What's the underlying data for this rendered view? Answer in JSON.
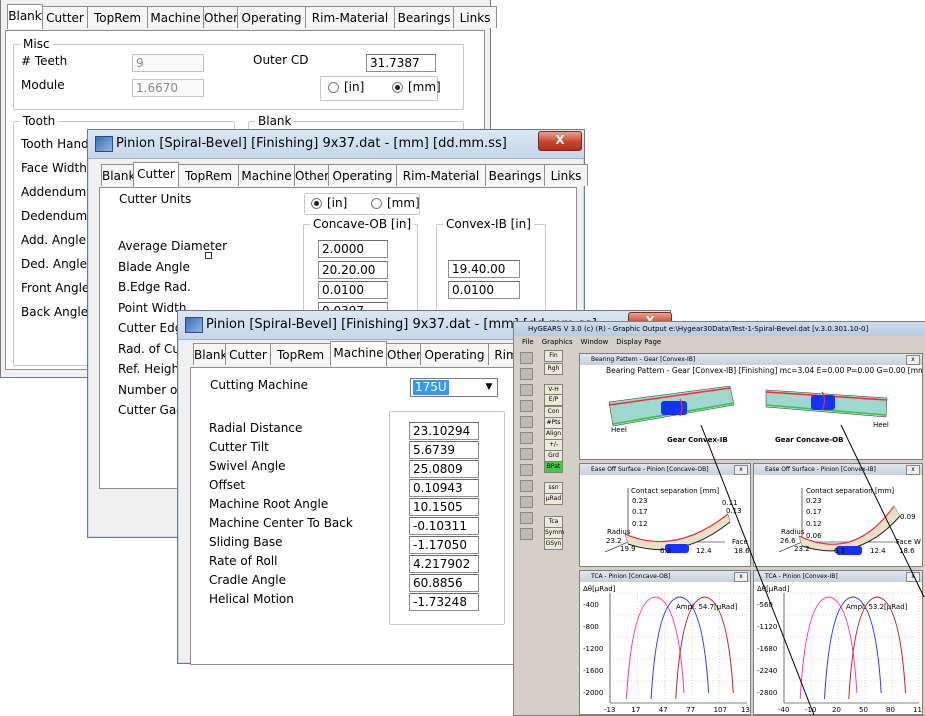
{
  "win1": {
    "tabs": [
      "Blank",
      "Cutter",
      "TopRem",
      "Machine",
      "Other",
      "Operating",
      "Rim-Material",
      "Bearings",
      "Links"
    ],
    "misc_label": "Misc",
    "teeth_label": "# Teeth",
    "teeth_value": "9",
    "module_label": "Module",
    "module_value": "1.6670",
    "outer_cd_label": "Outer CD",
    "outer_cd_value": "31.7387",
    "unit_in": "[in]",
    "unit_mm": "[mm]",
    "tooth_label": "Tooth",
    "blank_label": "Blank",
    "tooth_rows": [
      "Tooth Hand",
      "Face Width",
      "Addendum",
      "Dedendum",
      "Add. Angle",
      "Ded. Angle",
      "Front Angle",
      "Back Angle"
    ]
  },
  "win2": {
    "title": "Pinion [Spiral-Bevel] [Finishing] 9x37.dat - [mm] [dd.mm.ss]",
    "close": "X",
    "tabs": [
      "Blank",
      "Cutter",
      "TopRem",
      "Machine",
      "Other",
      "Operating",
      "Rim-Material",
      "Bearings",
      "Links"
    ],
    "cutter_units_label": "Cutter Units",
    "unit_in": "[in]",
    "unit_mm": "[mm]",
    "concave_label": "Concave-OB [in]",
    "convex_label": "Convex-IB [in]",
    "rows": [
      "Average Diameter",
      "Blade Angle",
      "B.Edge Rad.",
      "Point Width",
      "Cutter Edge",
      "Rad. of Curv",
      "Ref. Height",
      "Number of Bl",
      "Cutter Gaging"
    ],
    "concave_values": [
      "2.0000",
      "20.20.00",
      "0.0100",
      "0.0397"
    ],
    "convex_values": [
      "19.40.00",
      "0.0100"
    ]
  },
  "win3": {
    "title": "Pinion [Spiral-Bevel] [Finishing] 9x37.dat - [mm] [dd.mm.ss]",
    "close": "X",
    "tabs": [
      "Blank",
      "Cutter",
      "TopRem",
      "Machine",
      "Other",
      "Operating",
      "Rim"
    ],
    "cutting_machine_label": "Cutting Machine",
    "cutting_machine_value": "175U",
    "rows": [
      {
        "label": "Radial Distance",
        "value": "23.10294"
      },
      {
        "label": "Cutter Tilt",
        "value": "5.6739"
      },
      {
        "label": "Swivel Angle",
        "value": "25.0809"
      },
      {
        "label": "Offset",
        "value": "0.10943"
      },
      {
        "label": "Machine Root Angle",
        "value": "10.1505"
      },
      {
        "label": "Machine Center To Back",
        "value": "-0.10311"
      },
      {
        "label": "Sliding Base",
        "value": "-1.17050"
      },
      {
        "label": "Rate of Roll",
        "value": "4.217902"
      },
      {
        "label": "Cradle Angle",
        "value": "60.8856"
      },
      {
        "label": "Helical Motion",
        "value": "-1.73248"
      }
    ]
  },
  "hygears": {
    "title": "HyGEARS V 3.0 (c) (R) - Graphic Output e:\\Hygear30Data\\Test-1-Spiral-Bevel.dat [v.3.0.301.10-0]",
    "menu": [
      "File",
      "Graphics",
      "Window",
      "Display Page"
    ],
    "toolbar": [
      "Fin",
      "Rgh",
      "V-H",
      "E/P",
      "Con",
      "#Pts",
      "Align",
      "+/-",
      "Grd",
      "BPat",
      "ssn",
      "μRad",
      "Tca",
      "Symm",
      "GSyn"
    ],
    "bp_window_title": "Bearing Pattern - Gear [Convex-IB]",
    "bp_caption": "Bearing Pattern - Gear [Convex-IB] [Finishing] mc=3.04 E=0.00 P=0.00 G=0.00 [mm] B=0.077[mm]",
    "heel": "Heel",
    "gear_convex": "Gear Convex-IB",
    "gear_concave": "Gear Concave-OB",
    "eo_concave_title": "Ease Off Surface - Pinion [Concave-OB]",
    "eo_convex_title": "Ease Off Surface - Pinion [Convex-IB]",
    "contact_sep": "Contact separation [mm]",
    "eo1_vals": [
      "0.23",
      "0.17",
      "0.12",
      "0.11",
      "0.13"
    ],
    "eo1_axis": [
      "Radius",
      "23.2",
      "19.9",
      "6.2",
      "12.4",
      "18.6",
      "Face W"
    ],
    "eo2_vals": [
      "0.23",
      "0.17",
      "0.12",
      "0.06",
      "0.09"
    ],
    "eo2_axis": [
      "Radius",
      "26.6",
      "23.2",
      "6.2",
      "12.4",
      "18.6",
      "Face W"
    ],
    "tca_concave_title": "TCA - Pinion [Concave-OB]",
    "tca_convex_title": "TCA - Pinion [Convex-IB]",
    "tca_unit": "Δθ[μRad]",
    "tca1_ampl": "Ampl. 54.7[μRad]",
    "tca2_ampl": "Ampl. 53.2[μRad]",
    "tca1_y": [
      "-400",
      "-800",
      "-1200",
      "-1600",
      "-2000"
    ],
    "tca1_x": [
      "-13",
      "17",
      "47",
      "77",
      "107",
      "137"
    ],
    "tca2_y": [
      "-560",
      "-1120",
      "-1680",
      "-2240",
      "-2800"
    ],
    "tca2_x": [
      "-40",
      "-10",
      "20",
      "50",
      "80",
      "110"
    ]
  }
}
